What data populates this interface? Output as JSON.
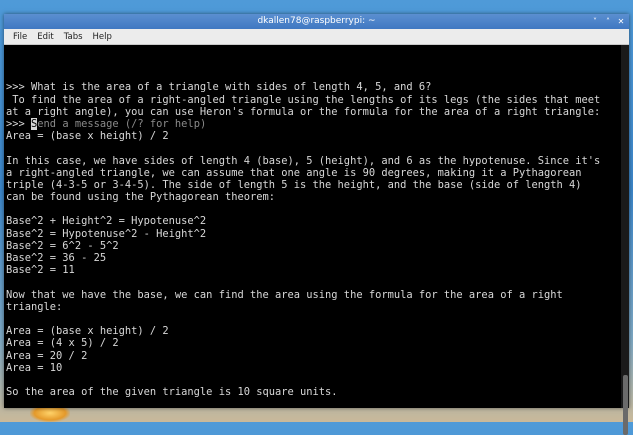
{
  "window": {
    "title": "dkallen78@raspberrypi: ~",
    "controls": [
      "˅",
      "˄",
      "✕"
    ]
  },
  "menu": [
    "File",
    "Edit",
    "Tabs",
    "Help"
  ],
  "terminal": {
    "lines": [
      ">>> What is the area of a triangle with sides of length 4, 5, and 6?",
      " To find the area of a right-angled triangle using the lengths of its legs (the sides that meet",
      "at a right angle), you can use Heron's formula or the formula for the area of a right triangle:",
      "",
      "Area = (base x height) / 2",
      "",
      "In this case, we have sides of length 4 (base), 5 (height), and 6 as the hypotenuse. Since it's",
      "a right-angled triangle, we can assume that one angle is 90 degrees, making it a Pythagorean",
      "triple (4-3-5 or 3-4-5). The side of length 5 is the height, and the base (side of length 4)",
      "can be found using the Pythagorean theorem:",
      "",
      "Base^2 + Height^2 = Hypotenuse^2",
      "Base^2 = Hypotenuse^2 - Height^2",
      "Base^2 = 6^2 - 5^2",
      "Base^2 = 36 - 25",
      "Base^2 = 11",
      "",
      "Now that we have the base, we can find the area using the formula for the area of a right",
      "triangle:",
      "",
      "Area = (base x height) / 2",
      "Area = (4 x 5) / 2",
      "Area = 20 / 2",
      "Area = 10",
      "",
      "So the area of the given triangle is 10 square units.",
      ""
    ],
    "prompt": ">>> ",
    "cursor_char": "S",
    "placeholder_rest": "end a message (/? for help)"
  }
}
